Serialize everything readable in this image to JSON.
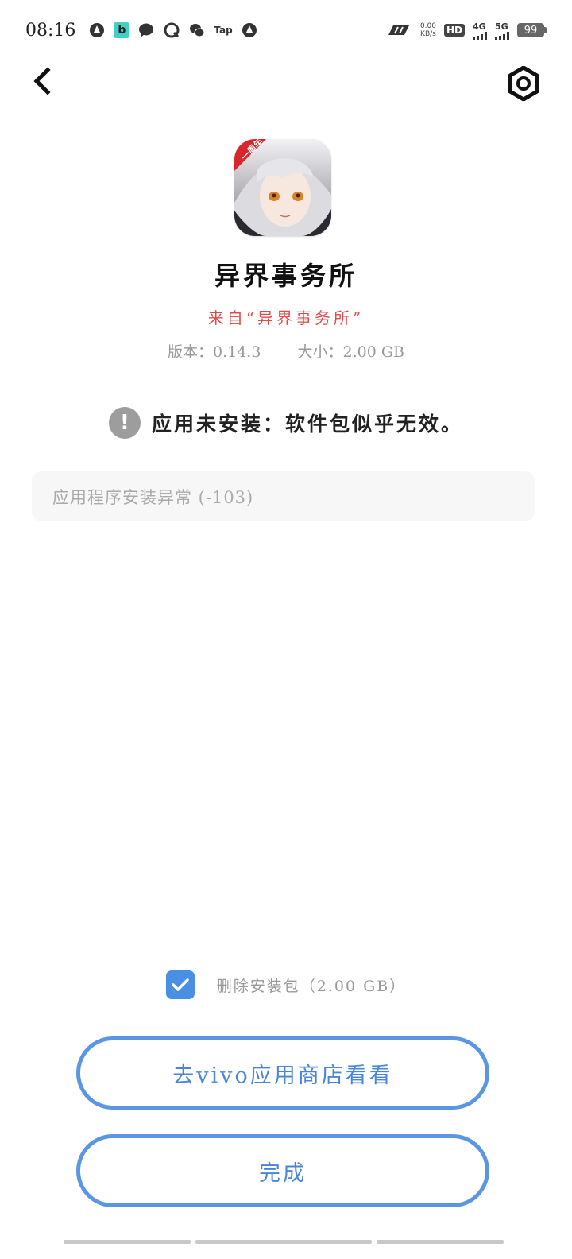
{
  "status_bar": {
    "time": "08:16",
    "net_speed_value": "0.00",
    "net_speed_unit": "KB/s",
    "hd_label": "HD",
    "sim_label": "1 2",
    "sig1_label": "4G",
    "sig2_label": "5G",
    "battery": "99",
    "tap_label": "Tap",
    "b_label": "b"
  },
  "header": {
    "back_icon": "chevron-left-icon",
    "settings_icon": "gear-icon"
  },
  "app": {
    "name": "异界事务所",
    "source": "来自“异界事务所”",
    "version": "版本：0.14.3",
    "size": "大小：2.00 GB",
    "icon_badge": "一周年"
  },
  "status": {
    "icon": "!",
    "message": "应用未安装：软件包似乎无效。"
  },
  "error_detail": "应用程序安装异常 (-103)",
  "delete_option": {
    "checked": true,
    "label": "删除安装包（2.00 GB）"
  },
  "buttons": {
    "store_label": "去vivo应用商店看看",
    "done_label": "完成"
  },
  "colors": {
    "accent": "#5b96e4",
    "source_red": "#e24a4a",
    "checkbox_blue": "#4a90e2"
  }
}
